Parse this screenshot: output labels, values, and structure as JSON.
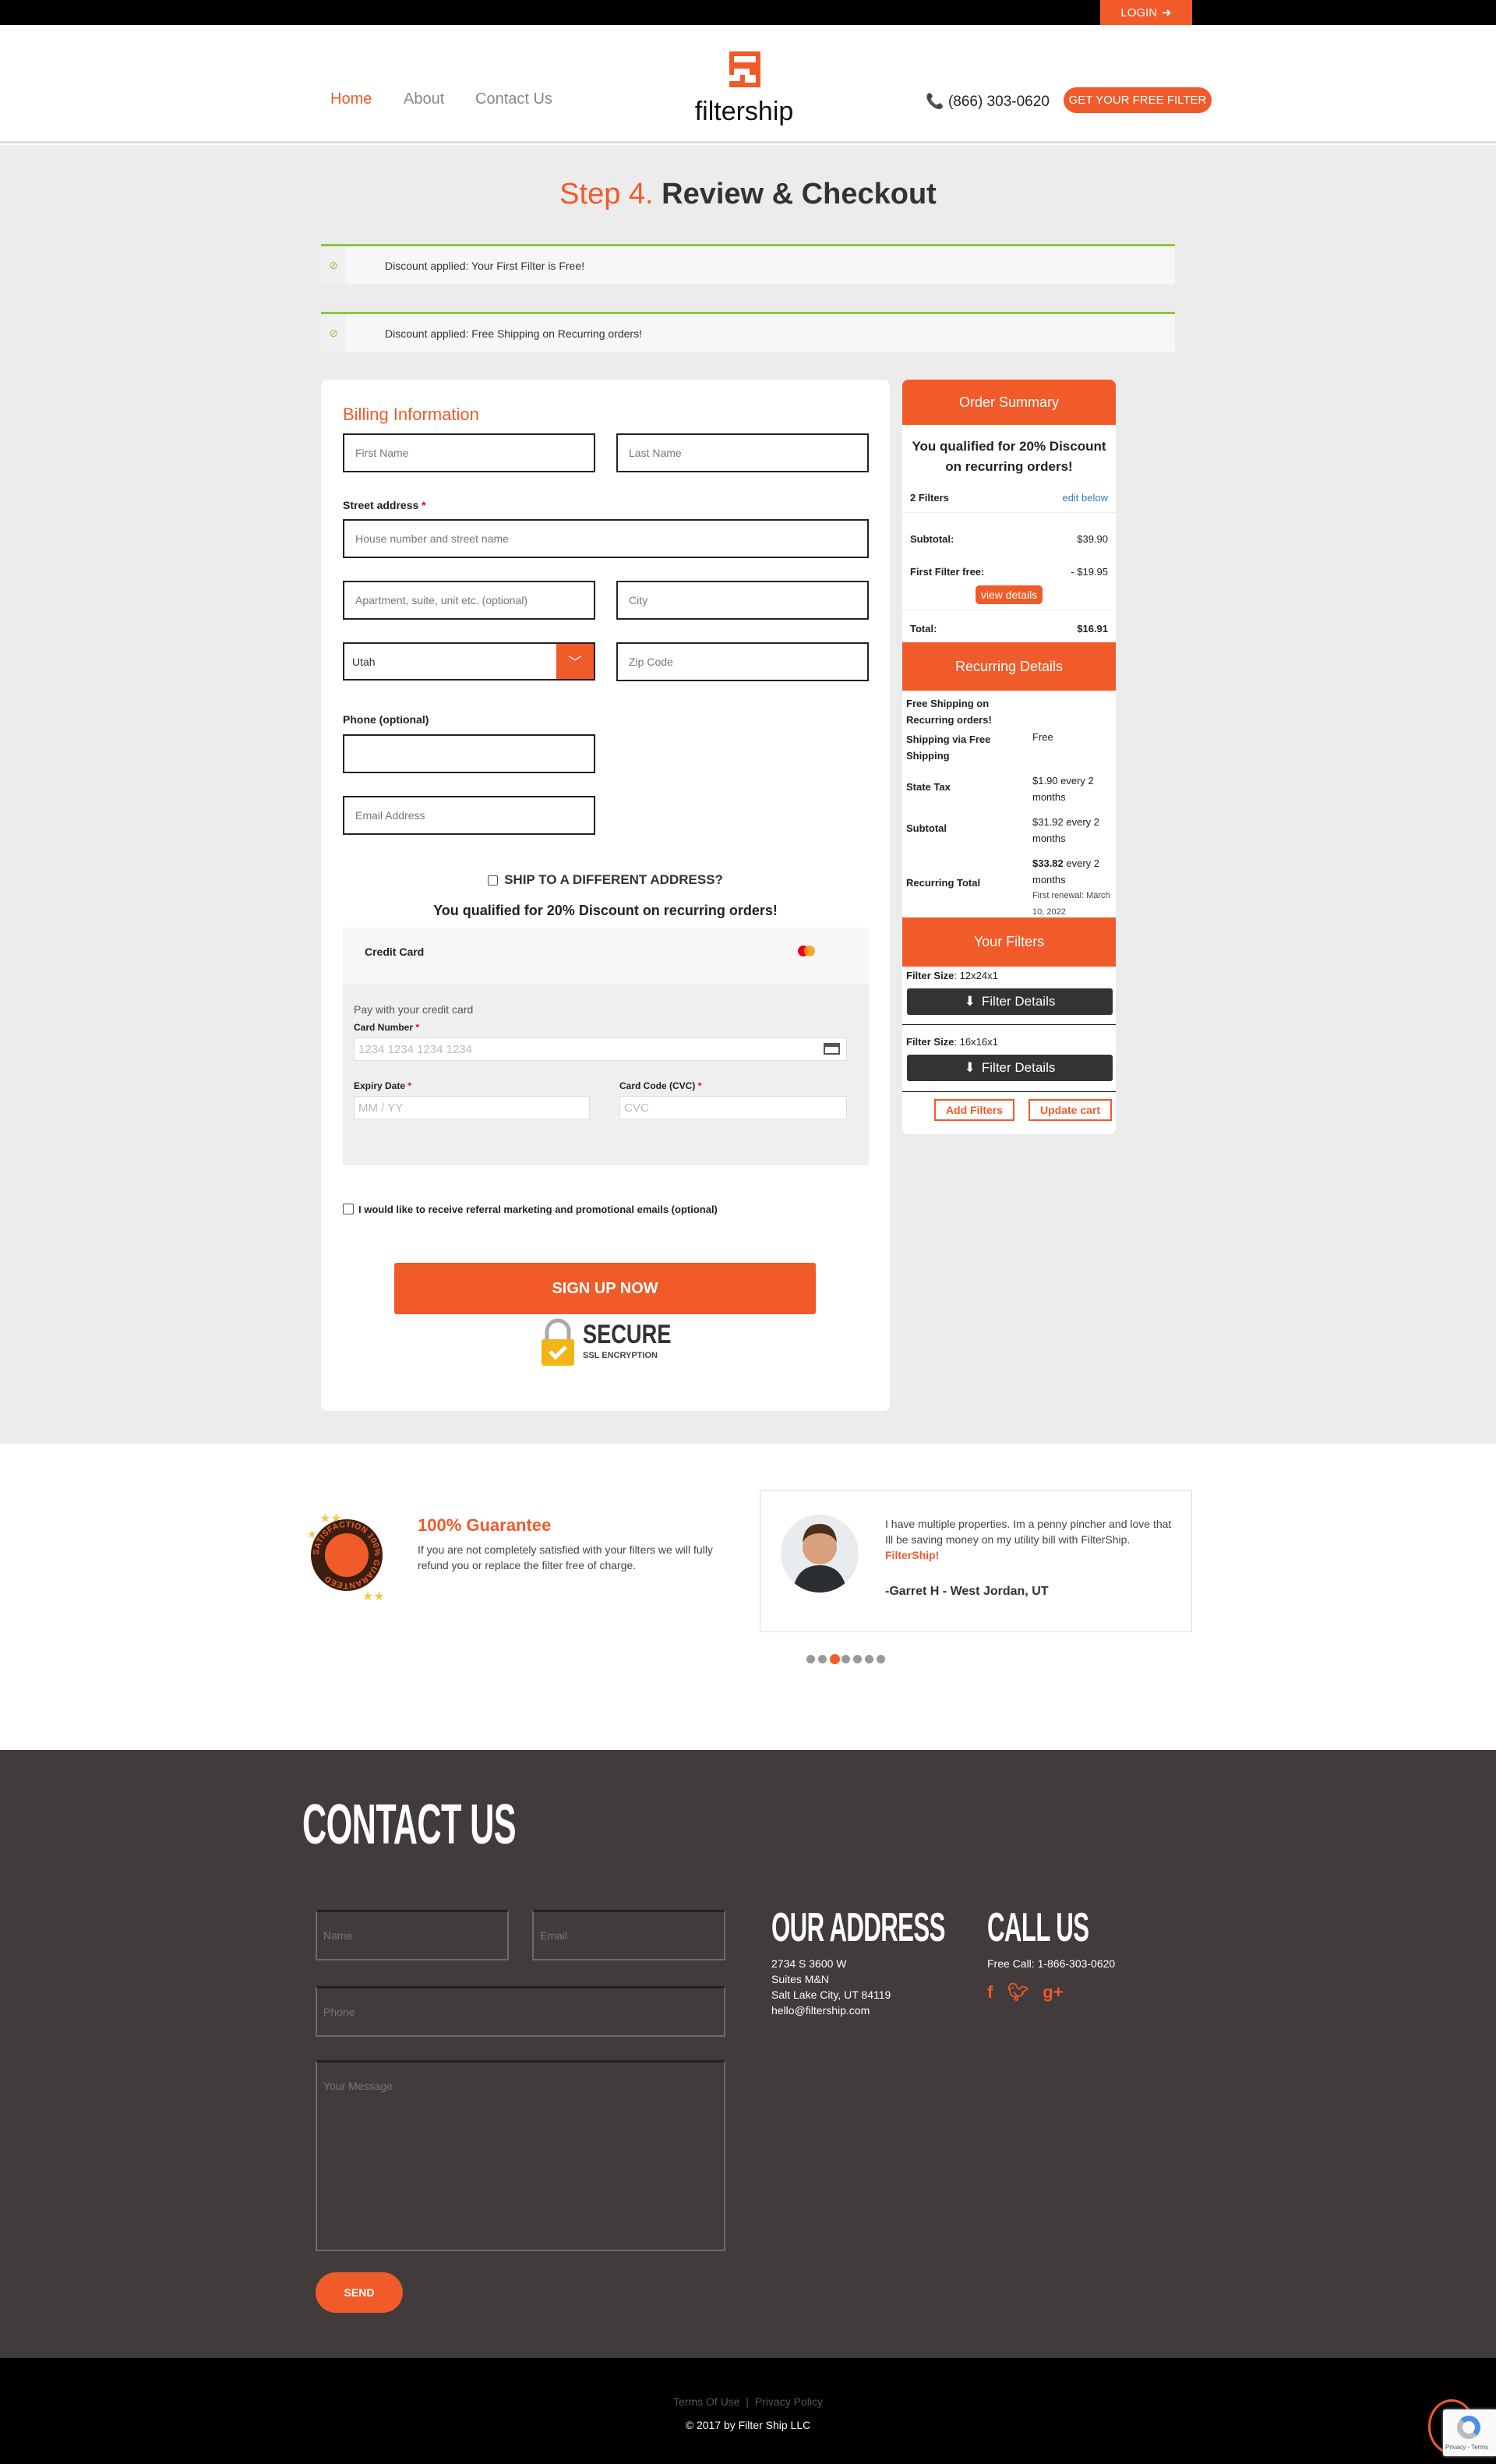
{
  "topbar": {
    "login_label": "LOGIN",
    "login_icon": "sign-in-icon"
  },
  "header": {
    "nav": [
      "Home",
      "About",
      "Contact Us"
    ],
    "logo_text": "filtership",
    "phone": "(866) 303-0620",
    "cta": "GET YOUR FREE FILTER"
  },
  "colors": {
    "accent": "#f15a29",
    "success": "#8dc63f",
    "dark": "#413b3b"
  },
  "page": {
    "step": "Step 4.",
    "title": "Review & Checkout"
  },
  "notices": [
    "Discount applied: Your First Filter is Free!",
    "Discount applied: Free Shipping on Recurring orders!"
  ],
  "billing": {
    "title": "Billing Information",
    "first_name": "First Name",
    "last_name": "Last Name",
    "street_label": "Street address",
    "street_placeholder": "House number and street name",
    "apt_placeholder": "Apartment, suite, unit etc. (optional)",
    "city_placeholder": "City",
    "state_value": "Utah",
    "zip_placeholder": "Zip Code",
    "phone_label": "Phone (optional)",
    "email_placeholder": "Email Address",
    "ship_different": "SHIP TO A DIFFERENT ADDRESS?",
    "qualified": "You qualified for 20% Discount on recurring orders!",
    "cc": {
      "title": "Credit Card",
      "pay_text": "Pay with your credit card",
      "card_number_label": "Card Number",
      "card_number_placeholder": "1234 1234 1234 1234",
      "expiry_label": "Expiry Date",
      "expiry_placeholder": "MM / YY",
      "cvc_label": "Card Code (CVC)",
      "cvc_placeholder": "CVC"
    },
    "marketing": "I would like to receive referral marketing and promotional emails (optional)",
    "submit": "SIGN UP NOW",
    "secure_title": "SECURE",
    "secure_sub": "SSL ENCRYPTION"
  },
  "summary": {
    "title": "Order Summary",
    "qualified": "You qualified for 20% Discount on recurring orders!",
    "filters_count": "2 Filters",
    "edit": "edit below",
    "subtotal_label": "Subtotal:",
    "subtotal": "$39.90",
    "free_label": "First Filter free:",
    "free": "- $19.95",
    "view_details": "view details",
    "total_label": "Total:",
    "total": "$16.91",
    "recurring_title": "Recurring Details",
    "free_shipping": "Free Shipping on Recurring orders!",
    "shipping_label": "Shipping via Free Shipping",
    "shipping": "Free",
    "tax_label": "State Tax",
    "tax": "$1.90 every 2 months",
    "rsub_label": "Subtotal",
    "rsub": "$31.92 every 2 months",
    "rtotal_label": "Recurring Total",
    "rtotal_amount": "$33.82",
    "rtotal_suffix": " every 2 months",
    "renewal": "First renewal: March 10, 2022",
    "filters_title": "Your Filters",
    "filters": [
      {
        "label": "Filter Size",
        "size": "12x24x1"
      },
      {
        "label": "Filter Size",
        "size": "16x16x1"
      }
    ],
    "filter_details": "Filter Details",
    "add_filters": "Add Filters",
    "update_cart": "Update cart"
  },
  "guarantee": {
    "title": "100% Guarantee",
    "text": "If you are not completely satisfied with your filters we will fully refund you or replace the filter free of charge.",
    "badge": "SATISFACTION 100% GUARANTEED"
  },
  "testimonial": {
    "text": "I have multiple properties. Im a penny pincher and love that Ill be saving money on my utility bill with FilterShip.",
    "brand": "FilterShip!",
    "author": "-Garret H - West Jordan, UT",
    "dots": 7,
    "active_dot": 3
  },
  "contact": {
    "title": "CONTACT US",
    "name": "Name",
    "email": "Email",
    "phone": "Phone",
    "message": "Your Message",
    "send": "SEND",
    "address_title": "OUR ADDRESS",
    "address": [
      "2734 S 3600 W",
      "Suites M&N",
      "Salt Lake City, UT 84119",
      "hello@filtership.com"
    ],
    "call_title": "CALL US",
    "call": "Free Call: 1-866-303-0620",
    "social": [
      "facebook-icon",
      "twitter-icon",
      "google-plus-icon"
    ]
  },
  "footer": {
    "terms": "Terms Of Use",
    "sep": "|",
    "privacy": "Privacy Policy",
    "copyright": "© 2017 by Filter Ship LLC",
    "recaptcha": "Privacy - Terms"
  }
}
